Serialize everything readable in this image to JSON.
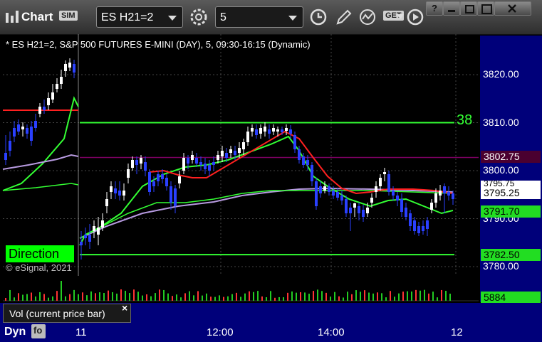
{
  "toolbar": {
    "app_title": "Chart",
    "sim_badge": "SIM",
    "symbol": "ES H21=2",
    "interval": "5",
    "get_badge": "GET"
  },
  "chart": {
    "header": "* ES H21=2, S&P 500 FUTURES E-MINI (DAY), 5, 09:30-16:15 (Dynamic)",
    "copyright": "© eSignal, 2021",
    "direction_label": "Direction",
    "line_label_38": "38"
  },
  "axis": {
    "ticks": [
      "3820.00",
      "3810.00",
      "3800.00",
      "3790.00",
      "3780.00"
    ],
    "tag_top_hidden": "3795.75",
    "tag_purple": "3802.75",
    "tag_last": "3795.25",
    "tag_green": "3791.70",
    "tag_lower": "3782.50",
    "vol_tag": "5884"
  },
  "volume_panel": {
    "label": "Vol (current price bar)",
    "close_symbol": "×"
  },
  "time_axis": {
    "labels": [
      "11",
      "12:00",
      "14:00",
      "12"
    ],
    "dyn_label": "Dyn"
  },
  "colors": {
    "up_candle": "#ffffff",
    "down_candle": "#2a40ff",
    "ma_fast": "#ff2020",
    "ma_green": "#33ff33",
    "vwap": "#b79ae0",
    "axis_bg": "#00007a"
  },
  "chart_data": {
    "type": "candlestick",
    "symbol": "ES H21=2",
    "interval": "5",
    "x_labels": [
      "11",
      "12:00",
      "14:00",
      "12"
    ],
    "y_ticks": [
      3780,
      3790,
      3800,
      3810,
      3820
    ],
    "ylim": [
      3778,
      3828
    ],
    "reference_lines": [
      {
        "value": 3810.0,
        "color": "#33ff33"
      },
      {
        "value": 3802.75,
        "color": "#800060"
      },
      {
        "value": 3782.5,
        "color": "#33ff33"
      }
    ],
    "last_price": 3795.25,
    "volume_last": 5884
  }
}
